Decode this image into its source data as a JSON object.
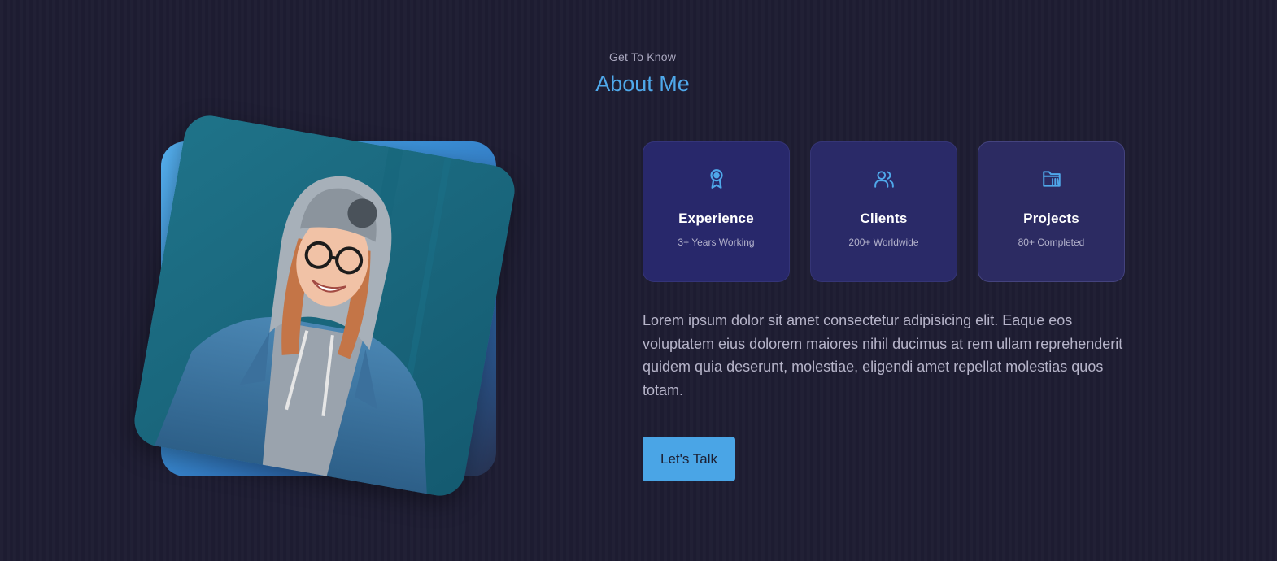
{
  "section": {
    "subtitle": "Get To Know",
    "title": "About Me"
  },
  "portrait": {
    "icon": "portrait-photo",
    "accent": "#4fa8ea"
  },
  "cards": [
    {
      "icon": "award-icon",
      "title": "Experience",
      "subtitle": "3+ Years Working"
    },
    {
      "icon": "users-icon",
      "title": "Clients",
      "subtitle": "200+ Worldwide"
    },
    {
      "icon": "folder-icon",
      "title": "Projects",
      "subtitle": "80+ Completed"
    }
  ],
  "about_text": "Lorem ipsum dolor sit amet consectetur adipisicing elit. Eaque eos voluptatem eius dolorem maiores nihil ducimus at rem ullam reprehenderit quidem quia deserunt, molestiae, eligendi amet repellat molestias quos totam.",
  "cta": {
    "label": "Let's Talk"
  },
  "colors": {
    "background": "#1e1d33",
    "accent": "#4fa8ea",
    "card": "#28286b",
    "button": "#4aa5e6"
  }
}
